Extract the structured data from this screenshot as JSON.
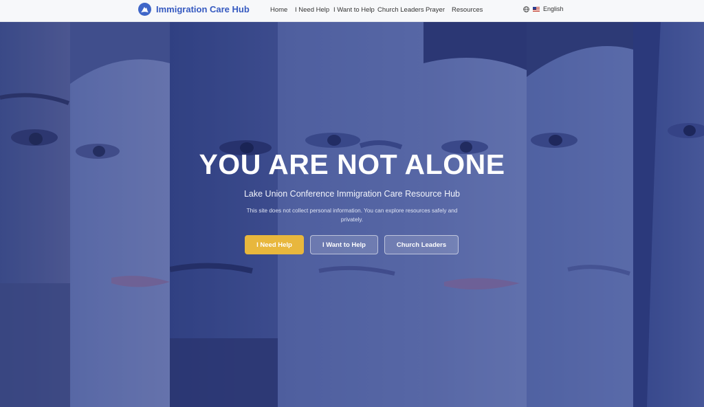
{
  "header": {
    "brand": "Immigration Care Hub",
    "nav": [
      {
        "id": "home",
        "label": "Home"
      },
      {
        "id": "need-help",
        "label": "I Need Help"
      },
      {
        "id": "want-help",
        "label": "I Want to Help"
      },
      {
        "id": "church-leaders",
        "label": "Church Leaders"
      },
      {
        "id": "prayer",
        "label": "Prayer"
      },
      {
        "id": "resources",
        "label": "Resources"
      }
    ],
    "language": "English"
  },
  "hero": {
    "title": "YOU ARE NOT ALONE",
    "subtitle": "Lake Union Conference Immigration Care Resource Hub",
    "note": "This site does not collect personal information. You can explore resources safely and privately.",
    "buttons": {
      "need_help": "I Need Help",
      "want_help": "I Want to Help",
      "church_leaders": "Church Leaders"
    }
  },
  "colors": {
    "brand_blue": "#3559c0",
    "hero_overlay": "#2c4296",
    "accent_yellow": "#e8b73d"
  },
  "icons": [
    "church-logo-icon",
    "globe-icon",
    "us-flag-icon"
  ]
}
